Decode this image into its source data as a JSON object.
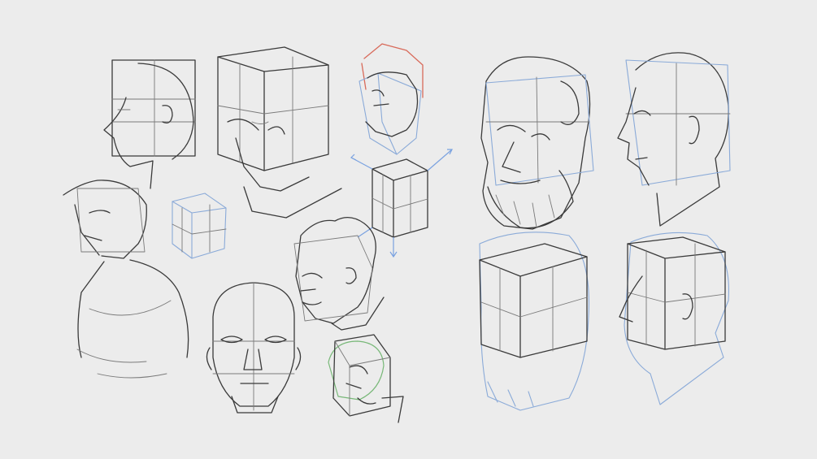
{
  "image": {
    "background_color": "#ececec",
    "pencil_color": "#3a3a3a",
    "construction_blue": "#8aaad8",
    "construction_red": "#d86a5a",
    "construction_green": "#78b878"
  }
}
